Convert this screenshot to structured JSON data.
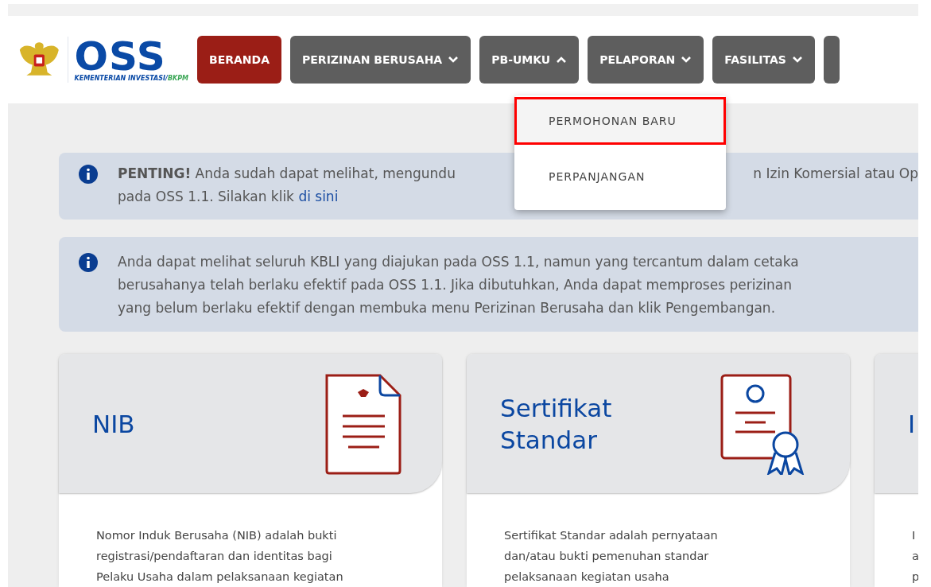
{
  "header": {
    "logo_text": "OSS",
    "logo_subtitle": "KEMENTERIAN INVESTASI/",
    "logo_subtitle_accent": "BKPM"
  },
  "nav": [
    {
      "label": "BERANDA",
      "kind": "link",
      "selected": true
    },
    {
      "label": "PERIZINAN BERUSAHA",
      "kind": "dropdown",
      "selected": false,
      "expanded": false
    },
    {
      "label": "PB-UMKU",
      "kind": "dropdown",
      "selected": false,
      "expanded": true
    },
    {
      "label": "PELAPORAN",
      "kind": "dropdown",
      "selected": false,
      "expanded": false
    },
    {
      "label": "FASILITAS",
      "kind": "dropdown",
      "selected": false,
      "expanded": false
    }
  ],
  "dropdown": {
    "items": [
      {
        "label": "PERMOHONAN BARU",
        "selected": true
      },
      {
        "label": "PERPANJANGAN",
        "selected": false
      }
    ]
  },
  "notices": [
    {
      "line_1_start": "**PENTING!** Anda sudah dapat melihat, mengundu",
      "line_1_end": "n Izin Komersial atau Op",
      "line_2": "pada OSS 1.1. Silakan klik ",
      "link": "di sini"
    },
    {
      "lines": [
        "Anda dapat melihat seluruh KBLI yang diajukan pada OSS 1.1, namun yang tercantum dalam cetaka",
        "berusahanya telah berlaku efektif pada OSS 1.1. Jika dibutuhkan, Anda dapat memproses perizinan",
        "yang belum berlaku efektif dengan membuka menu Perizinan Berusaha dan klik Pengembangan."
      ]
    }
  ],
  "cards": [
    {
      "title": "NIB",
      "kind": "document",
      "description": [
        "Nomor Induk Berusaha (NIB) adalah bukti",
        "registrasi/pendaftaran dan identitas bagi",
        "Pelaku Usaha dalam pelaksanaan kegiatan"
      ]
    },
    {
      "title": "Sertifikat Standar",
      "kind": "certificate",
      "description": [
        "Sertifikat Standar adalah pernyataan",
        "dan/atau bukti pemenuhan standar",
        "pelaksanaan kegiatan usaha"
      ]
    },
    {
      "title": "I",
      "kind": "none",
      "description": [
        "I",
        "a",
        "p"
      ]
    }
  ]
}
